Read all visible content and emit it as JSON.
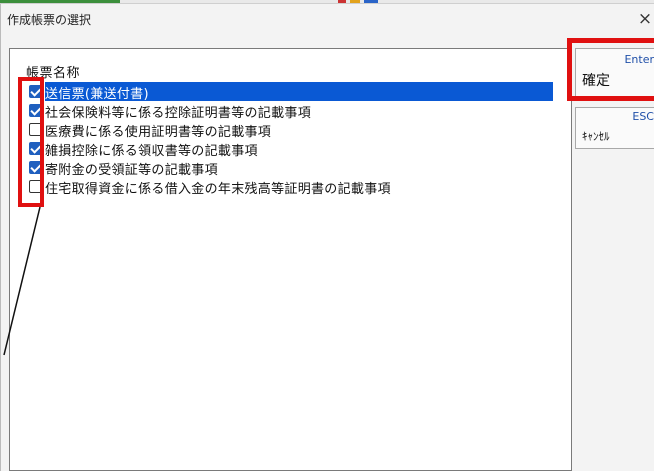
{
  "dialog": {
    "title": "作成帳票の選択",
    "close_icon": "×"
  },
  "list": {
    "header": "帳票名称",
    "items": [
      {
        "label": "送信票(兼送付書)",
        "checked": true,
        "selected": true
      },
      {
        "label": "社会保険料等に係る控除証明書等の記載事項",
        "checked": true,
        "selected": false
      },
      {
        "label": "医療費に係る使用証明書等の記載事項",
        "checked": false,
        "selected": false
      },
      {
        "label": "雑損控除に係る領収書等の記載事項",
        "checked": true,
        "selected": false
      },
      {
        "label": "寄附金の受領証等の記載事項",
        "checked": true,
        "selected": false
      },
      {
        "label": "住宅取得資金に係る借入金の年末残高等証明書の記載事項",
        "checked": false,
        "selected": false
      }
    ]
  },
  "buttons": {
    "ok": {
      "key": "Enter",
      "label": "確定"
    },
    "cancel": {
      "key": "ESC",
      "label": "ｷｬﾝｾﾙ"
    }
  },
  "colors": {
    "selection": "#0a59d4",
    "checkbox_checked": "#1f5fbf",
    "annotation": "#e01010"
  }
}
